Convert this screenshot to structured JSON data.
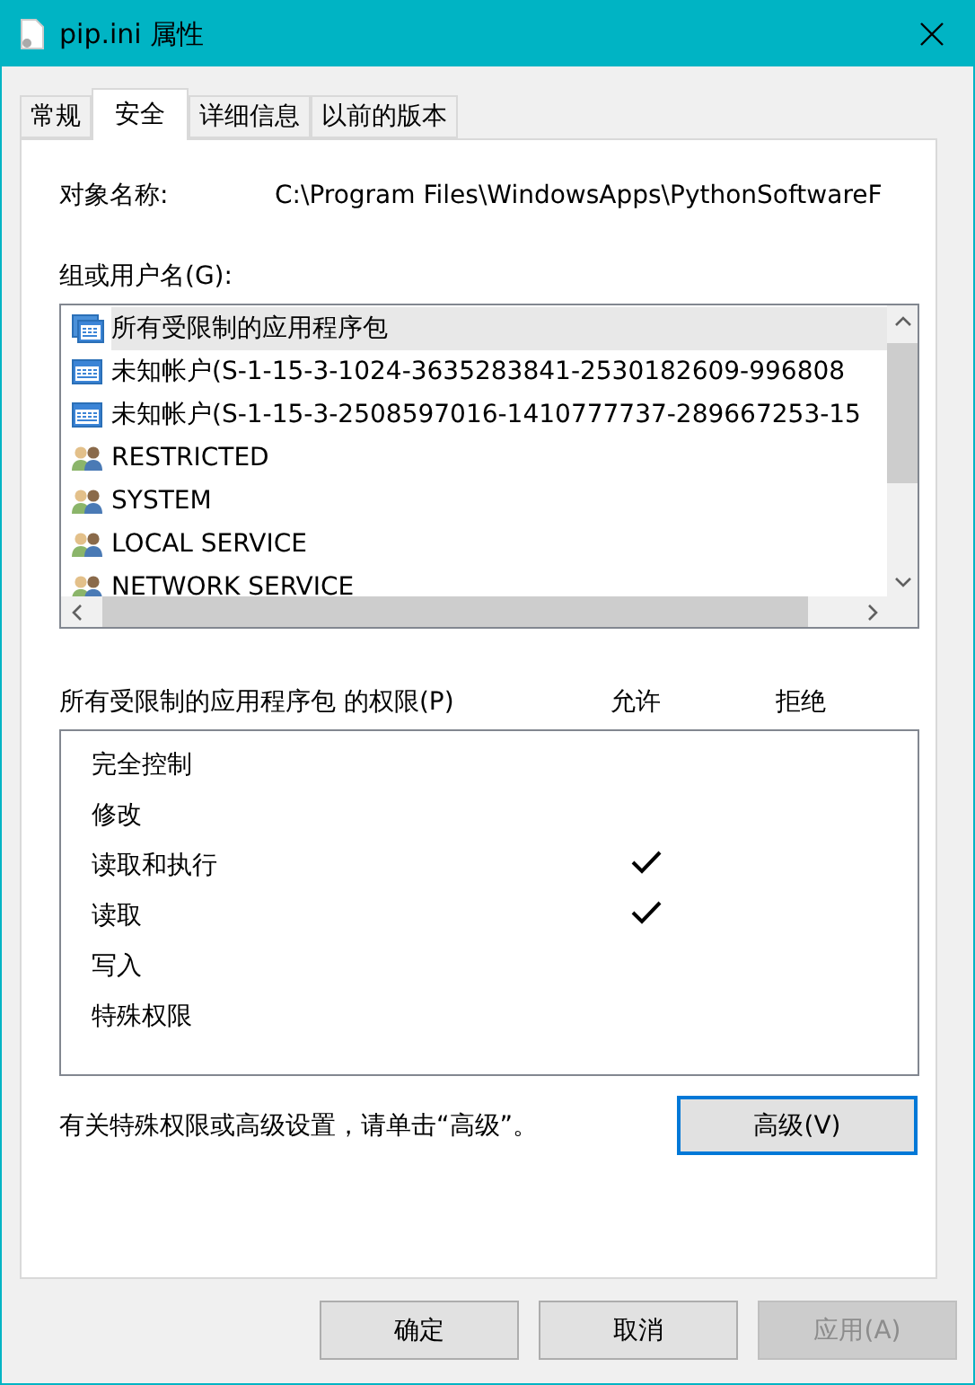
{
  "window": {
    "title": "pip.ini 属性"
  },
  "tabs": [
    {
      "label": "常规",
      "selected": false
    },
    {
      "label": "安全",
      "selected": true
    },
    {
      "label": "详细信息",
      "selected": false
    },
    {
      "label": "以前的版本",
      "selected": false
    }
  ],
  "object_name": {
    "label": "对象名称:",
    "value": "C:\\Program Files\\WindowsApps\\PythonSoftwareF"
  },
  "groups": {
    "label": "组或用户名(G):",
    "items": [
      {
        "name": "所有受限制的应用程序包",
        "kind": "package",
        "selected": true
      },
      {
        "name": "未知帐户(S-1-15-3-1024-3635283841-2530182609-996808",
        "kind": "account",
        "selected": false
      },
      {
        "name": "未知帐户(S-1-15-3-2508597016-1410777737-289667253-15",
        "kind": "account",
        "selected": false
      },
      {
        "name": "RESTRICTED",
        "kind": "group",
        "selected": false
      },
      {
        "name": "SYSTEM",
        "kind": "group",
        "selected": false
      },
      {
        "name": "LOCAL SERVICE",
        "kind": "group",
        "selected": false
      },
      {
        "name": "NETWORK SERVICE",
        "kind": "group",
        "selected": false
      }
    ]
  },
  "permissions": {
    "label": "所有受限制的应用程序包 的权限(P)",
    "allow_label": "允许",
    "deny_label": "拒绝",
    "rows": [
      {
        "name": "完全控制",
        "allow": false,
        "deny": false
      },
      {
        "name": "修改",
        "allow": false,
        "deny": false
      },
      {
        "name": "读取和执行",
        "allow": true,
        "deny": false
      },
      {
        "name": "读取",
        "allow": true,
        "deny": false
      },
      {
        "name": "写入",
        "allow": false,
        "deny": false
      },
      {
        "name": "特殊权限",
        "allow": false,
        "deny": false
      }
    ]
  },
  "advanced_note": "有关特殊权限或高级设置，请单击“高级”。",
  "advanced_button": "高级(V)",
  "buttons": [
    {
      "label": "确定",
      "disabled": false
    },
    {
      "label": "取消",
      "disabled": false
    },
    {
      "label": "应用(A)",
      "disabled": true
    }
  ]
}
